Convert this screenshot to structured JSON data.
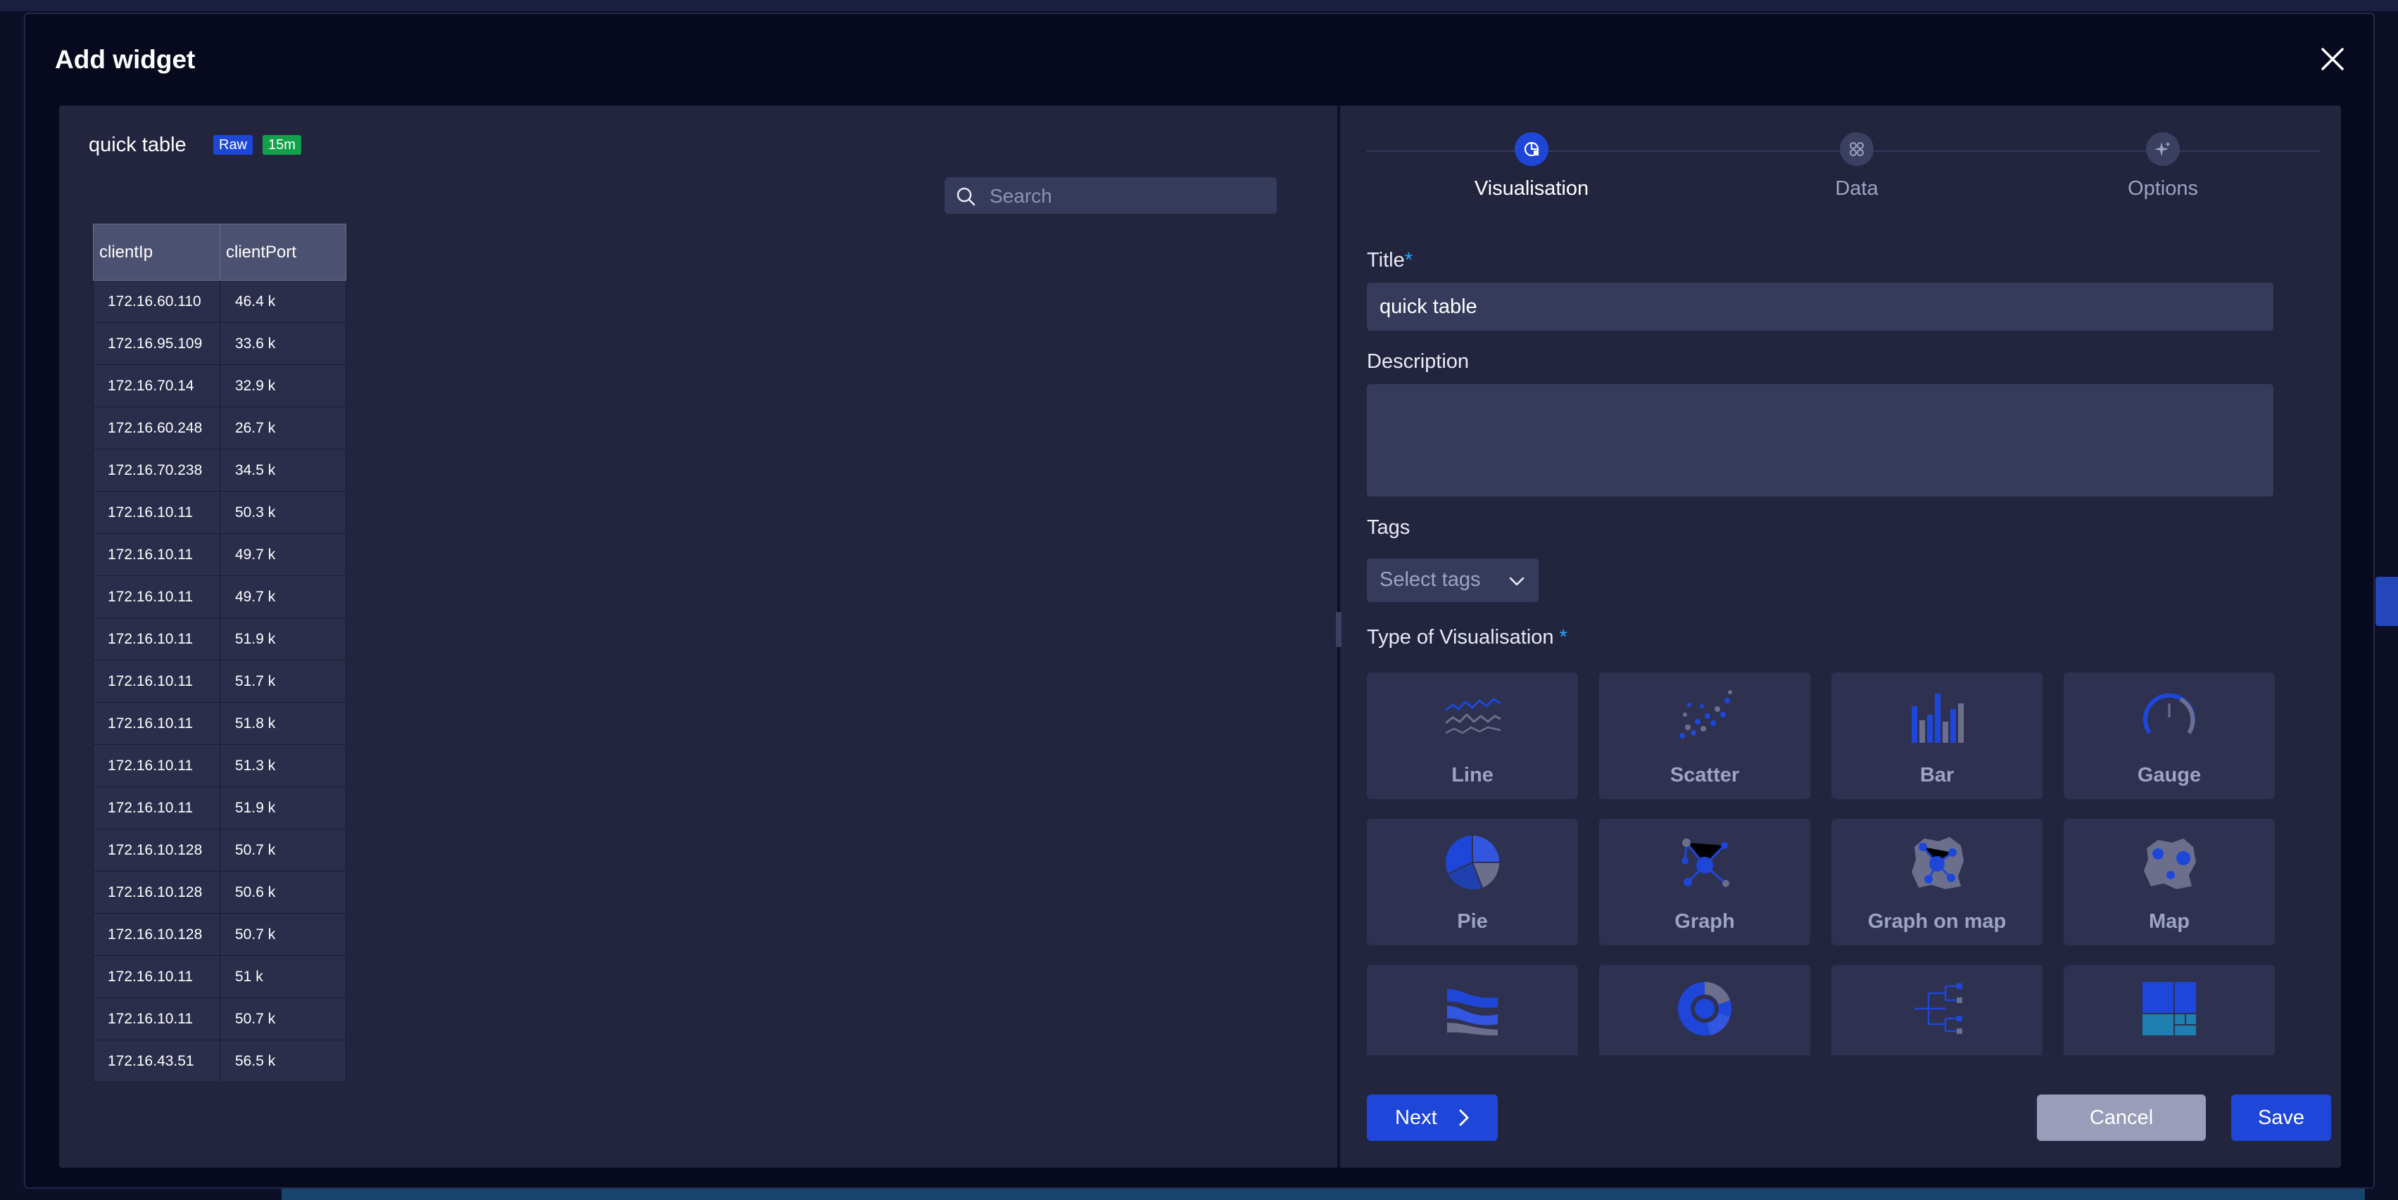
{
  "modal": {
    "title": "Add widget"
  },
  "preview": {
    "title": "quick table",
    "badges": {
      "raw": "Raw",
      "time": "15m"
    },
    "search": {
      "placeholder": "Search"
    },
    "table": {
      "columns": [
        "clientIp",
        "clientPort"
      ],
      "rows": [
        [
          "172.16.60.110",
          "46.4 k"
        ],
        [
          "172.16.95.109",
          "33.6 k"
        ],
        [
          "172.16.70.14",
          "32.9 k"
        ],
        [
          "172.16.60.248",
          "26.7 k"
        ],
        [
          "172.16.70.238",
          "34.5 k"
        ],
        [
          "172.16.10.11",
          "50.3 k"
        ],
        [
          "172.16.10.11",
          "49.7 k"
        ],
        [
          "172.16.10.11",
          "49.7 k"
        ],
        [
          "172.16.10.11",
          "51.9 k"
        ],
        [
          "172.16.10.11",
          "51.7 k"
        ],
        [
          "172.16.10.11",
          "51.8 k"
        ],
        [
          "172.16.10.11",
          "51.3 k"
        ],
        [
          "172.16.10.11",
          "51.9 k"
        ],
        [
          "172.16.10.128",
          "50.7 k"
        ],
        [
          "172.16.10.128",
          "50.6 k"
        ],
        [
          "172.16.10.128",
          "50.7 k"
        ],
        [
          "172.16.10.11",
          "51 k"
        ],
        [
          "172.16.10.11",
          "50.7 k"
        ],
        [
          "172.16.43.51",
          "56.5 k"
        ]
      ]
    }
  },
  "steps": [
    {
      "label": "Visualisation",
      "icon": "chart-icon",
      "active": true
    },
    {
      "label": "Data",
      "icon": "data-icon",
      "active": false
    },
    {
      "label": "Options",
      "icon": "sparkle-icon",
      "active": false
    }
  ],
  "form": {
    "title_label": "Title",
    "title_value": "quick table",
    "required_mark": "*",
    "description_label": "Description",
    "description_value": "",
    "tags_label": "Tags",
    "tags_placeholder": "Select tags",
    "viz_label": "Type of Visualisation",
    "viz_required_mark": "*"
  },
  "visualisations": [
    {
      "name": "Line",
      "icon": "line-chart-icon"
    },
    {
      "name": "Scatter",
      "icon": "scatter-chart-icon"
    },
    {
      "name": "Bar",
      "icon": "bar-chart-icon"
    },
    {
      "name": "Gauge",
      "icon": "gauge-icon"
    },
    {
      "name": "Pie",
      "icon": "pie-chart-icon"
    },
    {
      "name": "Graph",
      "icon": "graph-icon"
    },
    {
      "name": "Graph on map",
      "icon": "graph-on-map-icon"
    },
    {
      "name": "Map",
      "icon": "map-icon"
    },
    {
      "name": "",
      "icon": "sankey-icon"
    },
    {
      "name": "",
      "icon": "sunburst-icon"
    },
    {
      "name": "",
      "icon": "tree-icon"
    },
    {
      "name": "",
      "icon": "treemap-icon"
    }
  ],
  "buttons": {
    "next": "Next",
    "cancel": "Cancel",
    "save": "Save"
  },
  "colors": {
    "accent": "#1e47d9",
    "raw_badge": "#1e47d9",
    "time_badge": "#13a04a",
    "required": "#23a9ff"
  }
}
